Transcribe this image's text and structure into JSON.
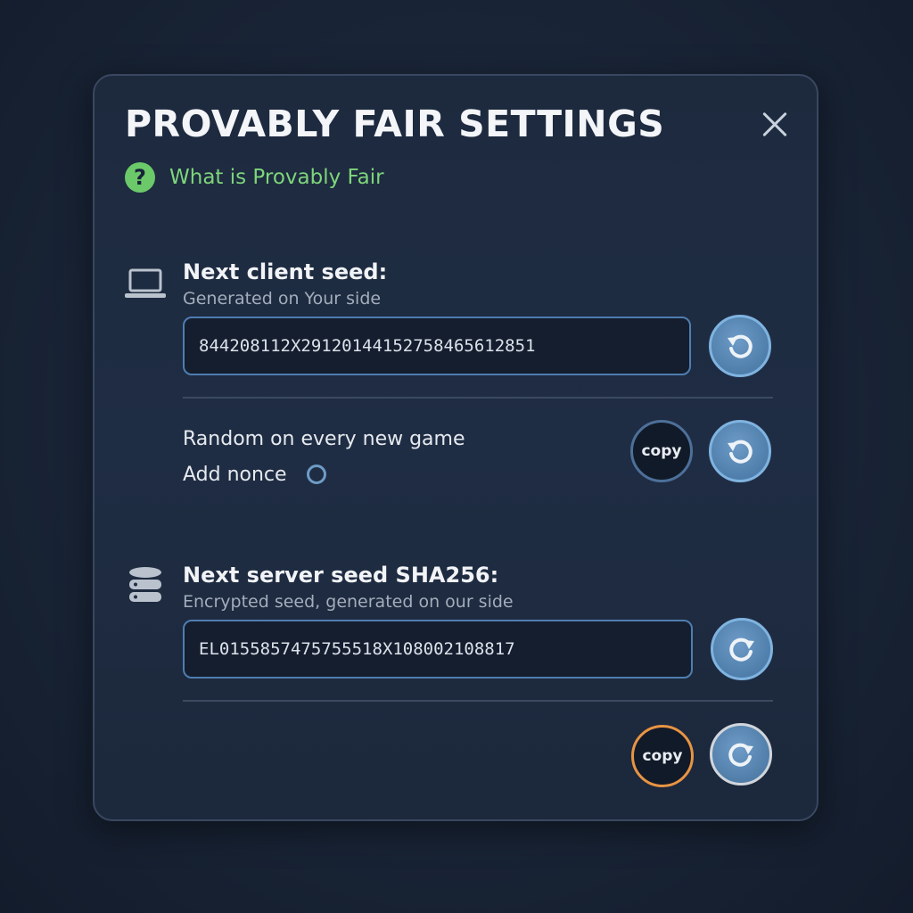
{
  "modal": {
    "title": "PROVABLY FAIR SETTINGS",
    "help_link": "What is Provably Fair",
    "help_icon": "question-mark",
    "close_icon": "close-x"
  },
  "client": {
    "icon": "laptop-icon",
    "title": "Next client seed:",
    "subtitle": "Generated on Your side",
    "seed_value": "844208112X291201441527584656128​51",
    "random_label": "Random on every new game",
    "nonce_label": "Add nonce",
    "copy_label": "copy"
  },
  "server": {
    "icon": "database-icon",
    "title": "Next server seed SHA256:",
    "subtitle": "Encrypted seed, generated on our side",
    "seed_value": "EL0155857475755518X108002108817",
    "copy_label": "copy"
  },
  "colors": {
    "accent_green": "#7ed57b",
    "button_blue": "#4f7eab",
    "button_orange_border": "#e89443",
    "background": "#1a2639"
  }
}
